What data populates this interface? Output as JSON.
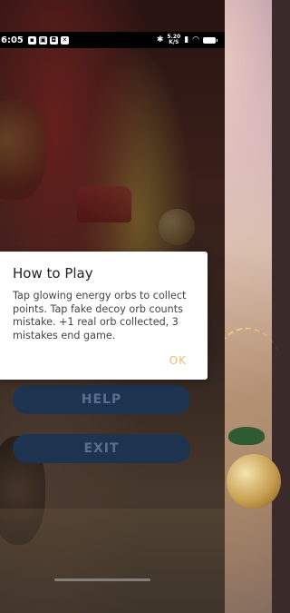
{
  "status_bar": {
    "time": "6:05",
    "network_speed_value": "5.20",
    "network_speed_unit": "K/S",
    "left_icons": [
      "notification-icon",
      "image-icon",
      "app-icon",
      "tools-icon"
    ],
    "right_icons": [
      "bluetooth-icon",
      "sim-icon",
      "wifi-icon",
      "battery-icon"
    ]
  },
  "menu": {
    "help_label": "HELP",
    "exit_label": "EXIT"
  },
  "dialog": {
    "title": "How to Play",
    "message": "Tap glowing energy orbs to collect points. Tap fake decoy orb counts mistake. +1 real orb collected, 3 mistakes end game.",
    "ok_label": "OK"
  },
  "colors": {
    "button_bg": "#1d3350",
    "button_text": "#5c6e90",
    "ok_accent": "#e8c07a",
    "dialog_bg": "#ffffff"
  }
}
